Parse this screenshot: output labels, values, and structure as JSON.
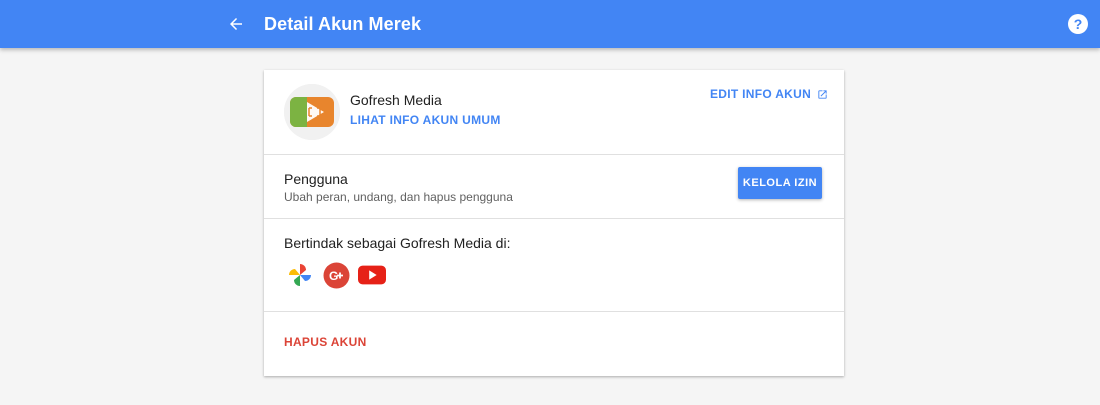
{
  "header": {
    "title": "Detail Akun Merek",
    "back_icon": "arrow-back-icon",
    "help_icon": "help-icon",
    "help_glyph": "?",
    "bar_color": "#4285f4"
  },
  "account": {
    "name": "Gofresh Media",
    "view_info_label": "LIHAT INFO AKUN UMUM",
    "edit_info_label": "EDIT INFO AKUN",
    "edit_icon": "open-in-new-icon"
  },
  "users": {
    "title": "Pengguna",
    "subtitle": "Ubah peran, undang, dan hapus pengguna",
    "manage_label": "KELOLA IZIN"
  },
  "act_as": {
    "label": "Bertindak sebagai Gofresh Media di:",
    "services": [
      {
        "name": "google-photos",
        "icon": "pinwheel-icon"
      },
      {
        "name": "google-plus",
        "icon": "google-plus-icon"
      },
      {
        "name": "youtube",
        "icon": "youtube-icon"
      }
    ]
  },
  "danger": {
    "delete_label": "HAPUS AKUN",
    "color": "#db4437"
  },
  "colors": {
    "accent": "#4285f4",
    "background": "#f5f5f5"
  }
}
